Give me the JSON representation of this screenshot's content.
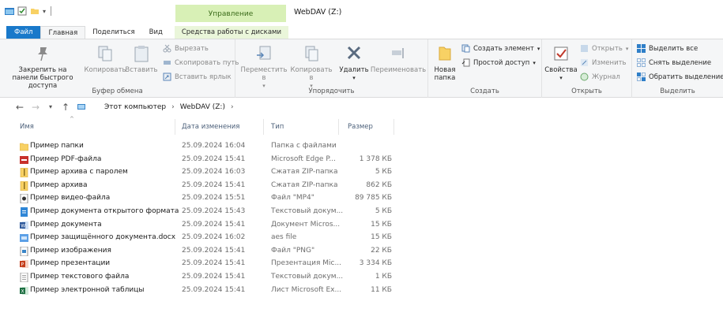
{
  "window": {
    "title": "WebDAV (Z:)"
  },
  "ribbon_context_header": "Управление",
  "tabs": [
    {
      "label": "Файл"
    },
    {
      "label": "Главная"
    },
    {
      "label": "Поделиться"
    },
    {
      "label": "Вид"
    },
    {
      "label": "Средства работы с дисками"
    }
  ],
  "groups": {
    "clipboard": {
      "label": "Буфер обмена",
      "pin": "Закрепить на панели быстрого доступа",
      "copy": "Копировать",
      "paste": "Вставить",
      "cut": "Вырезать",
      "copy_path": "Скопировать путь",
      "paste_shortcut": "Вставить ярлык"
    },
    "organize": {
      "label": "Упорядочить",
      "move": "Переместить в",
      "copy_to": "Копировать в",
      "delete": "Удалить",
      "rename": "Переименовать"
    },
    "create": {
      "label": "Создать",
      "new_folder": "Новая папка",
      "new_item": "Создать элемент",
      "easy_access": "Простой доступ"
    },
    "open": {
      "label": "Открыть",
      "properties": "Свойства",
      "open": "Открыть",
      "edit": "Изменить",
      "history": "Журнал"
    },
    "select": {
      "label": "Выделить",
      "select_all": "Выделить все",
      "select_none": "Снять выделение",
      "invert": "Обратить выделение"
    }
  },
  "breadcrumb": [
    "Этот компьютер",
    "WebDAV (Z:)"
  ],
  "columns": {
    "name": "Имя",
    "date": "Дата изменения",
    "type": "Тип",
    "size": "Размер"
  },
  "files": [
    {
      "name": "Пример папки",
      "date": "25.09.2024 16:04",
      "type": "Папка с файлами",
      "size": "",
      "icon": "folder-icon"
    },
    {
      "name": "Пример PDF-файла",
      "date": "25.09.2024 15:41",
      "type": "Microsoft Edge P...",
      "size": "1 378 КБ",
      "icon": "pdf-icon"
    },
    {
      "name": "Пример архива с паролем",
      "date": "25.09.2024 16:03",
      "type": "Сжатая ZIP-папка",
      "size": "5 КБ",
      "icon": "zip-icon"
    },
    {
      "name": "Пример архива",
      "date": "25.09.2024 15:41",
      "type": "Сжатая ZIP-папка",
      "size": "862 КБ",
      "icon": "zip-icon"
    },
    {
      "name": "Пример видео-файла",
      "date": "25.09.2024 15:51",
      "type": "Файл \"MP4\"",
      "size": "89 785 КБ",
      "icon": "video-icon"
    },
    {
      "name": "Пример документа открытого формата",
      "date": "25.09.2024 15:43",
      "type": "Текстовый докум...",
      "size": "5 КБ",
      "icon": "odt-icon"
    },
    {
      "name": "Пример документа",
      "date": "25.09.2024 15:41",
      "type": "Документ Micros...",
      "size": "15 КБ",
      "icon": "word-icon"
    },
    {
      "name": "Пример защищённого документа.docx",
      "date": "25.09.2024 16:02",
      "type": "aes file",
      "size": "15 КБ",
      "icon": "aes-icon"
    },
    {
      "name": "Пример изображения",
      "date": "25.09.2024 15:41",
      "type": "Файл \"PNG\"",
      "size": "22 КБ",
      "icon": "image-icon"
    },
    {
      "name": "Пример презентации",
      "date": "25.09.2024 15:41",
      "type": "Презентация Mic...",
      "size": "3 334 КБ",
      "icon": "powerpoint-icon"
    },
    {
      "name": "Пример текстового файла",
      "date": "25.09.2024 15:41",
      "type": "Текстовый докум...",
      "size": "1 КБ",
      "icon": "text-file-icon"
    },
    {
      "name": "Пример электронной таблицы",
      "date": "25.09.2024 15:41",
      "type": "Лист Microsoft Ex...",
      "size": "11 КБ",
      "icon": "excel-icon"
    }
  ],
  "colors": {
    "accent": "#1979ca",
    "context_tab": "#d8f0b6",
    "folder": "#f8d164"
  }
}
